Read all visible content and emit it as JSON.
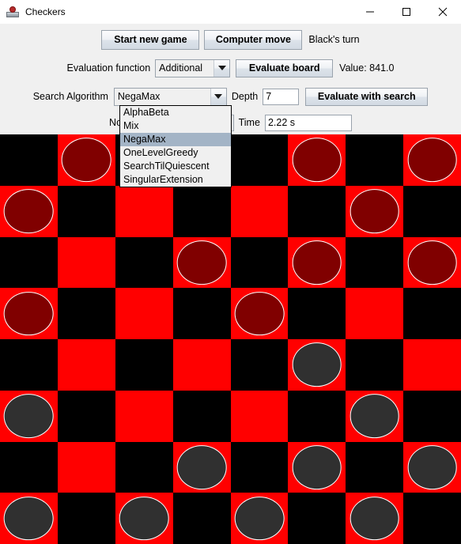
{
  "window": {
    "title": "Checkers",
    "icon": "checkers-app-icon",
    "minimize_label": "Minimize",
    "maximize_label": "Maximize",
    "close_label": "Close"
  },
  "controls": {
    "start_new_game": "Start new game",
    "computer_move": "Computer move",
    "turn_status": "Black's turn",
    "evaluation_function_label": "Evaluation function",
    "evaluation_function_value": "Additional",
    "evaluate_board": "Evaluate board",
    "value_label": "Value: 841.0",
    "search_algorithm_label": "Search Algorithm",
    "search_algorithm_value": "NegaMax",
    "depth_label": "Depth",
    "depth_value": "7",
    "evaluate_with_search": "Evaluate with search",
    "nodes_label": "Nodes e",
    "nodes_value": "",
    "time_label": "Time",
    "time_value": "2.22 s"
  },
  "dropdown": {
    "open": true,
    "selected": "NegaMax",
    "items": [
      "AlphaBeta",
      "Mix",
      "NegaMax",
      "OneLevelGreedy",
      "SearchTilQuiescent",
      "SingularExtension"
    ]
  },
  "colors": {
    "light_square": "#ff0000",
    "dark_square": "#000000",
    "red_piece": "#800000",
    "black_piece": "#303030",
    "piece_outline": "#ffffff",
    "panel_bg": "#f0f0f0",
    "highlight": "#a3b4c6"
  },
  "board": {
    "size": 8,
    "rows": [
      [
        null,
        "red",
        null,
        "red",
        null,
        "red",
        null,
        "red"
      ],
      [
        "red",
        null,
        null,
        null,
        null,
        null,
        "red",
        null
      ],
      [
        null,
        null,
        null,
        "red",
        null,
        "red",
        null,
        "red"
      ],
      [
        "red",
        null,
        null,
        null,
        "red",
        null,
        null,
        null
      ],
      [
        null,
        null,
        null,
        null,
        null,
        "black",
        null,
        null
      ],
      [
        "black",
        null,
        null,
        null,
        null,
        null,
        "black",
        null
      ],
      [
        null,
        null,
        null,
        "black",
        null,
        "black",
        null,
        "black"
      ],
      [
        "black",
        null,
        "black",
        null,
        "black",
        null,
        "black",
        null
      ]
    ]
  }
}
